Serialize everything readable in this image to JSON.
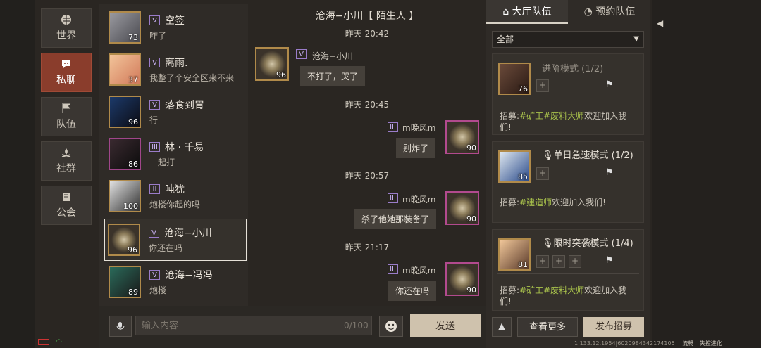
{
  "nav": [
    "世界",
    "私聊",
    "队伍",
    "社群",
    "公会"
  ],
  "contacts": [
    {
      "name": "空签",
      "msg": "咋了",
      "rank": "V",
      "level": "73"
    },
    {
      "name": "离雨.",
      "msg": "我整了个安全区来不来",
      "rank": "V",
      "level": "37"
    },
    {
      "name": "落食到胃",
      "msg": "行",
      "rank": "V",
      "level": "96"
    },
    {
      "name": "林 · 千易",
      "msg": "一起打",
      "rank": "III",
      "level": "86"
    },
    {
      "name": "吨犹",
      "msg": "炮楼你起的吗",
      "rank": "II",
      "level": "100"
    },
    {
      "name": "沧海−小川",
      "msg": "你还在吗",
      "rank": "V",
      "level": "96"
    },
    {
      "name": "沧海−冯冯",
      "msg": "炮楼",
      "rank": "V",
      "level": "89"
    }
  ],
  "chat": {
    "title": "沧海−小川【 陌生人 】",
    "items": [
      {
        "time": "昨天 20:42"
      },
      {
        "name": "沧海−小川",
        "text": "不打了，哭了",
        "level": "96",
        "rank": "V"
      },
      {
        "time": "昨天 20:45"
      },
      {
        "name": "m晚风m",
        "text": "别炸了",
        "level": "90",
        "rank": "III"
      },
      {
        "time": "昨天 20:57"
      },
      {
        "name": "m晚风m",
        "text": "杀了他她那装备了",
        "level": "90",
        "rank": "III"
      },
      {
        "time": "昨天 21:17"
      },
      {
        "name": "m晚风m",
        "text": "你还在吗",
        "level": "90",
        "rank": "III"
      }
    ]
  },
  "input": {
    "placeholder": "输入内容",
    "counter": "0/100",
    "send": "发送"
  },
  "right": {
    "tabs": [
      "大厅队伍",
      "预约队伍"
    ],
    "filter": "全部",
    "teams": [
      {
        "mode": "进阶模式 (1/2)",
        "level": "76",
        "slots": [
          "+"
        ],
        "recruit_prefix": "招募:",
        "tags": [
          "#矿工",
          "#废料大师"
        ],
        "recruit_suffix": "欢迎加入我们!"
      },
      {
        "mode": "单日急速模式 (1/2)",
        "level": "85",
        "slots": [
          "+"
        ],
        "recruit_prefix": "招募:",
        "tags": [
          "#建造师"
        ],
        "recruit_suffix": "欢迎加入我们!"
      },
      {
        "mode": "限时突袭模式 (1/4)",
        "level": "81",
        "slots": [
          "+",
          "+",
          "+"
        ],
        "recruit_prefix": "招募:",
        "tags": [
          "#矿工",
          "#废料大师"
        ],
        "recruit_suffix": "欢迎加入我们!"
      }
    ],
    "more": "查看更多",
    "publish": "发布招募"
  },
  "status": {
    "version": "1.133.12.1954|6020984342174105",
    "label": "流畅",
    "brand": "失控进化"
  },
  "colors": {
    "accent": "#8a3d2c",
    "tag": "#a9c24c",
    "send": "#cfc2ad"
  }
}
